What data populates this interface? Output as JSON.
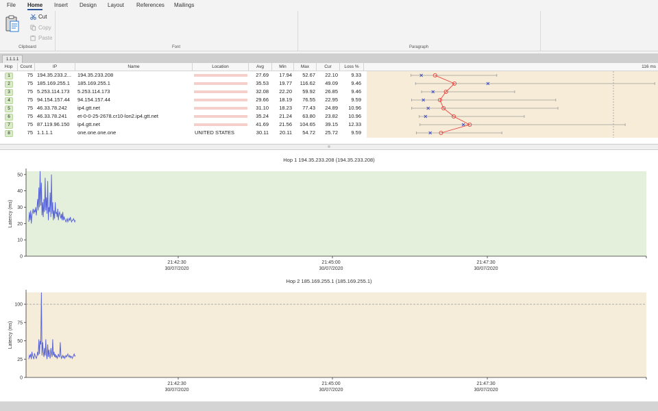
{
  "menu": {
    "tabs": [
      {
        "label": "File"
      },
      {
        "label": "Home",
        "active": true
      },
      {
        "label": "Insert"
      },
      {
        "label": "Design"
      },
      {
        "label": "Layout"
      },
      {
        "label": "References"
      },
      {
        "label": "Mailings"
      }
    ]
  },
  "ribbon": {
    "clipboard": {
      "cut": "Cut",
      "copy": "Copy",
      "paste": "Paste",
      "label": "Clipboard"
    },
    "font_label": "Font",
    "paragraph_label": "Paragraph"
  },
  "target": {
    "tab_label": "1.1.1.1"
  },
  "table": {
    "headers": [
      "Hop",
      "Count",
      "IP",
      "Name",
      "Location",
      "Avg",
      "Min",
      "Max",
      "Cur",
      "Loss %"
    ],
    "graph_label": "116 ms",
    "rows": [
      {
        "hop": "1",
        "count": "75",
        "ip": "194.35.233.2...",
        "name": "194.35.233.208",
        "location": "",
        "avg": "27.69",
        "min": "17.94",
        "max": "52.67",
        "cur": "22.10",
        "loss": "9.33"
      },
      {
        "hop": "2",
        "count": "75",
        "ip": "185.169.255.1",
        "name": "185.169.255.1",
        "location": "",
        "avg": "35.53",
        "min": "19.77",
        "max": "116.62",
        "cur": "49.09",
        "loss": "9.46"
      },
      {
        "hop": "3",
        "count": "75",
        "ip": "5.253.114.173",
        "name": "5.253.114.173",
        "location": "",
        "avg": "32.08",
        "min": "22.20",
        "max": "59.92",
        "cur": "26.85",
        "loss": "9.46"
      },
      {
        "hop": "4",
        "count": "75",
        "ip": "94.154.157.44",
        "name": "94.154.157.44",
        "location": "",
        "avg": "29.66",
        "min": "18.19",
        "max": "76.55",
        "cur": "22.95",
        "loss": "9.59"
      },
      {
        "hop": "5",
        "count": "75",
        "ip": "46.33.78.242",
        "name": "ip4.gtt.net",
        "location": "",
        "avg": "31.10",
        "min": "18.23",
        "max": "77.43",
        "cur": "24.89",
        "loss": "10.96"
      },
      {
        "hop": "6",
        "count": "75",
        "ip": "46.33.78.241",
        "name": "et-0-0-25-2678.cr10-lon2.ip4.gtt.net",
        "location": "",
        "avg": "35.24",
        "min": "21.24",
        "max": "63.80",
        "cur": "23.82",
        "loss": "10.96"
      },
      {
        "hop": "7",
        "count": "75",
        "ip": "87.119.96.150",
        "name": "ip4.gtt.net",
        "location": "",
        "avg": "41.69",
        "min": "21.56",
        "max": "104.65",
        "cur": "39.15",
        "loss": "12.33"
      },
      {
        "hop": "8",
        "count": "75",
        "ip": "1.1.1.1",
        "name": "one.one.one.one",
        "location": "UNITED STATES",
        "avg": "30.11",
        "min": "20.11",
        "max": "54.72",
        "cur": "25.72",
        "loss": "9.59"
      }
    ]
  },
  "charts": {
    "xticks": [
      {
        "time": "21:42:30",
        "date": "30/07/2020"
      },
      {
        "time": "21:45:00",
        "date": "30/07/2020"
      },
      {
        "time": "21:47:30",
        "date": "30/07/2020"
      }
    ],
    "chart1": {
      "title": "Hop 1 194.35.233.208 (194.35.233.208)",
      "ylabel": "Latency (ms)",
      "yticks": [
        "0",
        "10",
        "20",
        "30",
        "40",
        "50"
      ],
      "bg": "#e5f0dc"
    },
    "chart2": {
      "title": "Hop 2 185.169.255.1 (185.169.255.1)",
      "ylabel": "Latency (ms)",
      "yticks": [
        "0",
        "25",
        "50",
        "75",
        "100"
      ],
      "bg": "#f5ecd9"
    }
  },
  "chart_data": [
    {
      "type": "line",
      "title": "Hop 1 194.35.233.208 (194.35.233.208)",
      "ylabel": "Latency (ms)",
      "ylim": [
        0,
        52
      ],
      "x": [
        0,
        1,
        2,
        3,
        4,
        5,
        6,
        7,
        8,
        9,
        10,
        11,
        12,
        13,
        14,
        15,
        16,
        17,
        18,
        19,
        20,
        21,
        22,
        23,
        24,
        25,
        26,
        27,
        28,
        29,
        30,
        31,
        32,
        33,
        34,
        35,
        36,
        37,
        38,
        39,
        40,
        41,
        42,
        43,
        44,
        45,
        46,
        47,
        48,
        49,
        50,
        51,
        52,
        53,
        54,
        55,
        56,
        57,
        58,
        59,
        60,
        61,
        62,
        63,
        64,
        65,
        66,
        67,
        68,
        69,
        70,
        71,
        72,
        73,
        74
      ],
      "series": [
        {
          "values": [
            21,
            27,
            22,
            28,
            20,
            25,
            27,
            29,
            26,
            28,
            27,
            30,
            25,
            29,
            35,
            28,
            42,
            30,
            52,
            31,
            45,
            25,
            33,
            24,
            35,
            27,
            48,
            28,
            36,
            26,
            46,
            22,
            30,
            27,
            39,
            24,
            50,
            26,
            33,
            22,
            28,
            23,
            33,
            26,
            27,
            24,
            29,
            22,
            26,
            27,
            25,
            23,
            26,
            22,
            27,
            22,
            24,
            23,
            22,
            21,
            22,
            23,
            21,
            22,
            23,
            22,
            24,
            22,
            21,
            22,
            22,
            23,
            22,
            21,
            22
          ]
        }
      ]
    },
    {
      "type": "line",
      "title": "Hop 2 185.169.255.1 (185.169.255.1)",
      "ylabel": "Latency (ms)",
      "ylim": [
        0,
        116
      ],
      "x": [
        0,
        1,
        2,
        3,
        4,
        5,
        6,
        7,
        8,
        9,
        10,
        11,
        12,
        13,
        14,
        15,
        16,
        17,
        18,
        19,
        20,
        21,
        22,
        23,
        24,
        25,
        26,
        27,
        28,
        29,
        30,
        31,
        32,
        33,
        34,
        35,
        36,
        37,
        38,
        39,
        40,
        41,
        42,
        43,
        44,
        45,
        46,
        47,
        48,
        49,
        50,
        51,
        52,
        53,
        54,
        55,
        56,
        57,
        58,
        59,
        60,
        61,
        62,
        63,
        64,
        65,
        66,
        67,
        68,
        69,
        70,
        71,
        72,
        73,
        74
      ],
      "series": [
        {
          "values": [
            25,
            30,
            28,
            32,
            25,
            35,
            30,
            28,
            25,
            33,
            30,
            28,
            26,
            29,
            35,
            30,
            52,
            32,
            50,
            45,
            116,
            30,
            48,
            35,
            28,
            40,
            30,
            52,
            32,
            25,
            45,
            28,
            38,
            30,
            26,
            40,
            33,
            28,
            52,
            30,
            35,
            28,
            32,
            27,
            30,
            26,
            28,
            32,
            29,
            28,
            48,
            30,
            26,
            28,
            30,
            27,
            29,
            26,
            28,
            30,
            28,
            30,
            32,
            29,
            28,
            30,
            27,
            29,
            28,
            26,
            28,
            30,
            32,
            29,
            30
          ]
        }
      ]
    },
    {
      "type": "scatter",
      "title": "",
      "xlabel": "116 ms",
      "categories": [
        "1",
        "2",
        "3",
        "4",
        "5",
        "6",
        "7",
        "8"
      ],
      "series": [
        {
          "values": [
            27.69,
            35.53,
            32.08,
            29.66,
            31.1,
            35.24,
            41.69,
            30.11
          ]
        },
        {
          "values": [
            22.1,
            49.09,
            26.85,
            22.95,
            24.89,
            23.82,
            39.15,
            25.72
          ]
        },
        {
          "values": [
            17.94,
            19.77,
            22.2,
            18.19,
            18.23,
            21.24,
            21.56,
            20.11
          ]
        },
        {
          "values": [
            52.67,
            116.62,
            59.92,
            76.55,
            77.43,
            63.8,
            104.65,
            54.72
          ]
        }
      ],
      "xlim": [
        0,
        116
      ]
    }
  ]
}
